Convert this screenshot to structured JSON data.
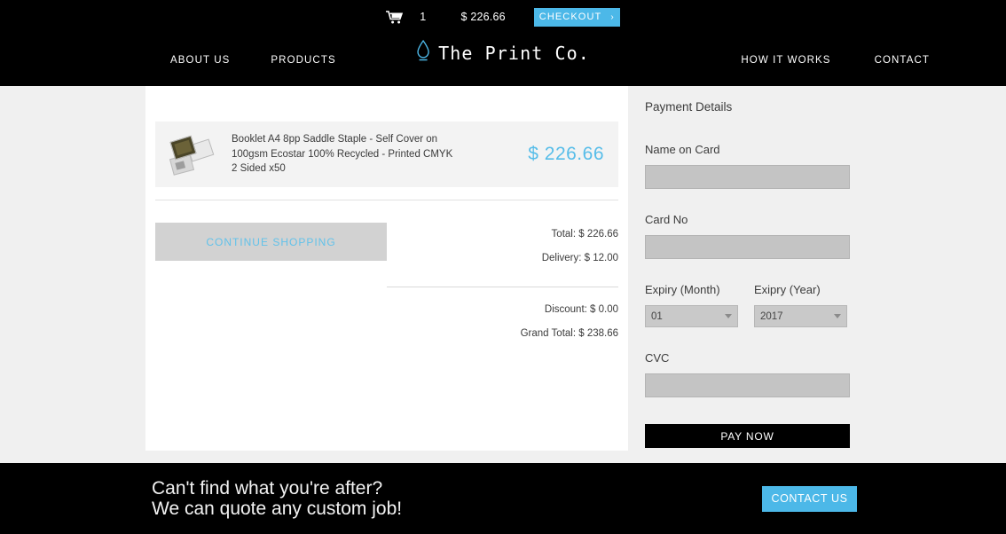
{
  "header": {
    "utility": {
      "cart_icon": "shopping-cart-icon",
      "cart_quantity": "1",
      "cart_total": "$ 226.66",
      "checkout_label": "CHECKOUT",
      "checkout_chevron": "›",
      "checkout_color": "#4cb8e8"
    },
    "nav_left": [
      {
        "label": "ABOUT US"
      },
      {
        "label": "PRODUCTS"
      }
    ],
    "nav_right": [
      {
        "label": "HOW IT WORKS"
      },
      {
        "label": "CONTACT"
      }
    ],
    "logo": {
      "icon": "water-drop-icon",
      "icon_color": "#4cb8e8",
      "text": "The Print Co."
    },
    "background_color": "#000000"
  },
  "cart": {
    "product": {
      "thumbnail": "booklet-product-thumbnail",
      "description": "Booklet A4 8pp Saddle Staple - Self Cover on 100gsm Ecostar 100% Recycled - Printed CMYK 2 Sided x50",
      "price": "$ 226.66",
      "price_color": "#57bde9"
    },
    "continue_shopping_label": "CONTINUE SHOPPING",
    "totals": [
      {
        "label": "Total: $ 226.66"
      },
      {
        "label": "Delivery: $ 12.00"
      }
    ],
    "totals_after": [
      {
        "label": "Discount: $ 0.00"
      },
      {
        "label": "Grand Total: $ 238.66"
      }
    ]
  },
  "payment": {
    "title": "Payment Details",
    "name_label": "Name on Card",
    "name_value": "",
    "card_label": "Card No",
    "card_value": "",
    "expiry_month_label": "Expiry (Month)",
    "expiry_month_value": "01",
    "expiry_year_label": "Exipry (Year)",
    "expiry_year_value": "2017",
    "cvc_label": "CVC",
    "cvc_value": "",
    "pay_now_label": "PAY NOW"
  },
  "footer": {
    "line1": "Can't find what you're after?",
    "line2": "We can quote any custom job!",
    "contact_label": "CONTACT US",
    "contact_color": "#4cb8e8"
  }
}
